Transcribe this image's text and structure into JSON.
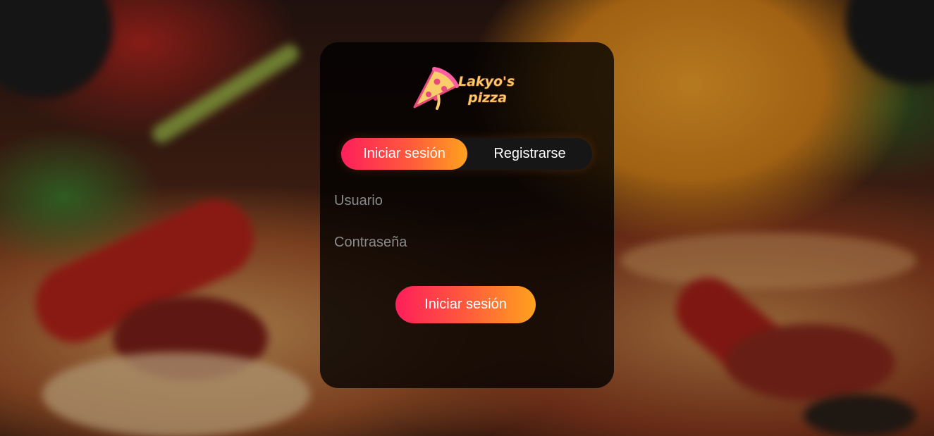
{
  "brand": {
    "logo_text_line1": "Lakyo's",
    "logo_text_line2": "pizza",
    "logo_icon": "pizza-slice-icon"
  },
  "tabs": {
    "login_label": "Iniciar sesión",
    "register_label": "Registrarse",
    "active": "login"
  },
  "form": {
    "username_placeholder": "Usuario",
    "username_value": "",
    "password_placeholder": "Contraseña",
    "password_value": "",
    "submit_label": "Iniciar sesión"
  },
  "colors": {
    "gradient_start": "#ff1f5a",
    "gradient_end": "#ffa21e",
    "card_background": "rgba(0,0,0,0.78)",
    "logo_yellow": "#f9cd6a",
    "logo_pink": "#ff5fa2"
  }
}
